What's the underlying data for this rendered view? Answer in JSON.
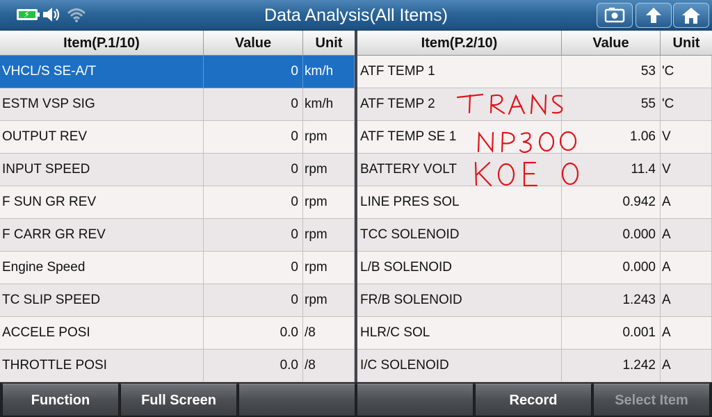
{
  "header": {
    "title": "Data Analysis(All Items)",
    "icons": [
      "battery-charging-icon",
      "speaker-icon",
      "wifi-icon",
      "screenshot-icon",
      "back-icon",
      "home-icon"
    ]
  },
  "left_table": {
    "headers": {
      "item": "Item(P.1/10)",
      "value": "Value",
      "unit": "Unit"
    },
    "rows": [
      {
        "item": "VHCL/S SE-A/T",
        "value": "0",
        "unit": "km/h",
        "selected": true
      },
      {
        "item": "ESTM VSP SIG",
        "value": "0",
        "unit": "km/h"
      },
      {
        "item": "OUTPUT REV",
        "value": "0",
        "unit": "rpm"
      },
      {
        "item": "INPUT SPEED",
        "value": "0",
        "unit": "rpm"
      },
      {
        "item": "F SUN GR REV",
        "value": "0",
        "unit": "rpm"
      },
      {
        "item": "F CARR GR REV",
        "value": "0",
        "unit": "rpm"
      },
      {
        "item": "Engine Speed",
        "value": "0",
        "unit": "rpm"
      },
      {
        "item": "TC SLIP SPEED",
        "value": "0",
        "unit": "rpm"
      },
      {
        "item": "ACCELE POSI",
        "value": "0.0",
        "unit": "/8"
      },
      {
        "item": "THROTTLE POSI",
        "value": "0.0",
        "unit": "/8"
      }
    ]
  },
  "right_table": {
    "headers": {
      "item": "Item(P.2/10)",
      "value": "Value",
      "unit": "Unit"
    },
    "rows": [
      {
        "item": "ATF TEMP 1",
        "value": "53",
        "unit": "'C"
      },
      {
        "item": "ATF TEMP 2",
        "value": "55",
        "unit": "'C"
      },
      {
        "item": "ATF TEMP SE 1",
        "value": "1.06",
        "unit": "V"
      },
      {
        "item": "BATTERY VOLT",
        "value": "11.4",
        "unit": "V"
      },
      {
        "item": "LINE PRES SOL",
        "value": "0.942",
        "unit": "A"
      },
      {
        "item": "TCC SOLENOID",
        "value": "0.000",
        "unit": "A"
      },
      {
        "item": "L/B SOLENOID",
        "value": "0.000",
        "unit": "A"
      },
      {
        "item": "FR/B SOLENOID",
        "value": "1.243",
        "unit": "A"
      },
      {
        "item": "HLR/C SOL",
        "value": "0.001",
        "unit": "A"
      },
      {
        "item": "I/C SOLENOID",
        "value": "1.242",
        "unit": "A"
      }
    ]
  },
  "annotation": {
    "lines": [
      "TRANS",
      "NP300",
      "KOEO"
    ],
    "color": "#e0141b"
  },
  "footer": {
    "buttons": [
      {
        "label": "Function",
        "enabled": true
      },
      {
        "label": "Full Screen",
        "enabled": true
      },
      {
        "label": "",
        "enabled": true
      },
      {
        "label": "",
        "enabled": true
      },
      {
        "label": "Record",
        "enabled": true
      },
      {
        "label": "Select Item",
        "enabled": false
      }
    ]
  },
  "colors": {
    "selected_row": "#1d6fc4",
    "title_bar": "#2b6598"
  }
}
